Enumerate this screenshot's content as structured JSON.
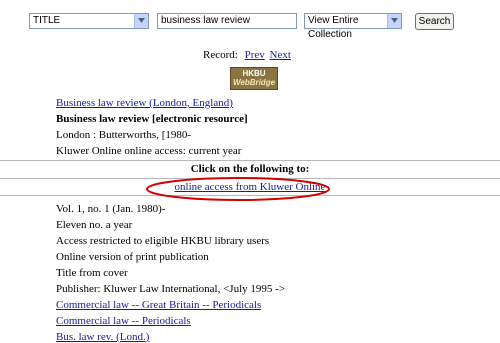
{
  "search": {
    "field_select": "TITLE",
    "query": "business law review",
    "scope_select": "View Entire Collection",
    "search_label": "Search"
  },
  "record_nav": {
    "label": "Record:",
    "prev": "Prev",
    "next": "Next"
  },
  "logo": {
    "line1": "HKBU",
    "line2": "WebBridge"
  },
  "record": {
    "series_link": "Business law review (London, England)",
    "title": "Business law review [electronic resource]",
    "publisher": "London : Butterworths, [1980-",
    "access": "Kluwer Online online access: current year"
  },
  "click_header": "Click on the following to:",
  "online_link": "online access from Kluwer Online",
  "details": [
    "Vol. 1, no. 1 (Jan. 1980)-",
    "Eleven no. a year",
    "Access restricted to eligible HKBU library users",
    "Online version of print publication",
    "Title from cover",
    "Publisher: Kluwer Law International, <July 1995 ->"
  ],
  "subject_links": [
    "Commercial law -- Great Britain -- Periodicals",
    "Commercial law -- Periodicals"
  ],
  "abbrev": "Bus. law rev. (Lond.)",
  "colors": {
    "link": "#1a1aa6",
    "highlight_oval": "#d40000",
    "logo_bg": "#8a7440"
  }
}
